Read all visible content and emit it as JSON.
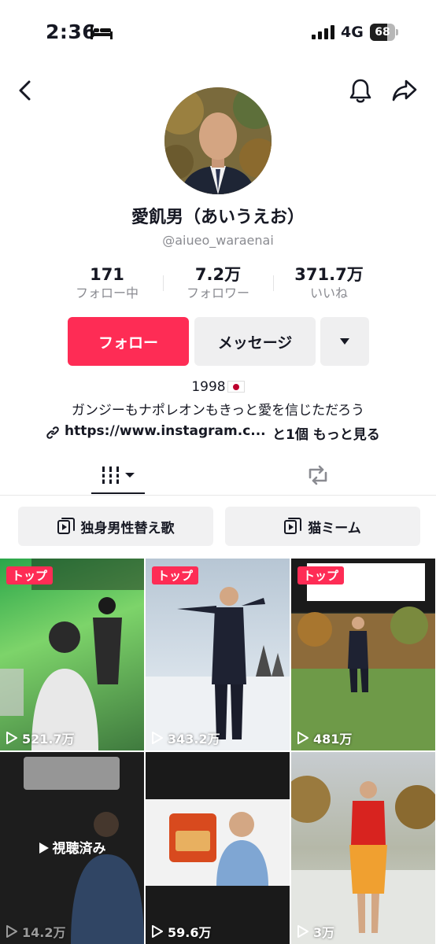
{
  "status": {
    "time": "2:36",
    "network": "4G",
    "battery": "68",
    "battery_level": 0.68
  },
  "profile": {
    "display_name": "愛飢男（あいうえお）",
    "username": "@aiueo_waraenai"
  },
  "stats": [
    {
      "value": "171",
      "label": "フォロー中"
    },
    {
      "value": "7.2万",
      "label": "フォロワー"
    },
    {
      "value": "371.7万",
      "label": "いいね"
    }
  ],
  "actions": {
    "follow_label": "フォロー",
    "message_label": "メッセージ"
  },
  "bio": {
    "year": "1998",
    "text": "ガンジーもナポレオンもきっと愛を信じただろう",
    "link": "https://www.instagram.c...",
    "more": "と1個 もっと見る"
  },
  "playlists": [
    {
      "label": "独身男性替え歌"
    },
    {
      "label": "猫ミーム"
    }
  ],
  "videos": [
    {
      "badge": "トップ",
      "views": "521.7万"
    },
    {
      "badge": "トップ",
      "views": "343.2万"
    },
    {
      "badge": "トップ",
      "views": "481万"
    },
    {
      "views": "14.2万",
      "status": "視聴済み"
    },
    {
      "views": "59.6万"
    },
    {
      "views": "3万"
    }
  ],
  "colors": {
    "accent": "#fe2c55",
    "secondary_bg": "#efeff0",
    "muted_text": "#8a8b91"
  }
}
